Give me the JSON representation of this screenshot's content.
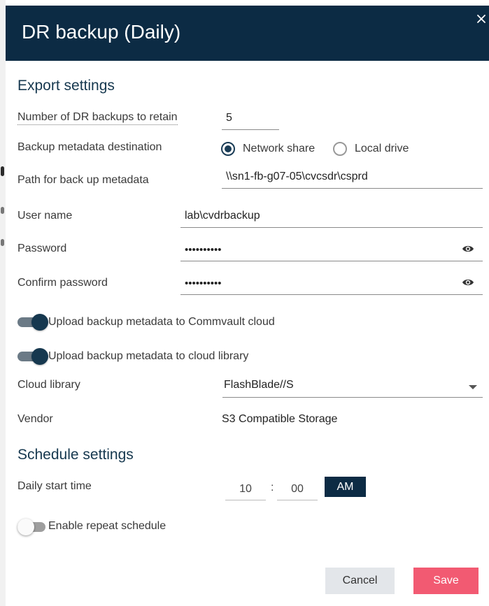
{
  "dialog": {
    "title": "DR backup (Daily)",
    "close_icon": "close-icon",
    "colors": {
      "header": "#0c2b44",
      "accent": "#16384f",
      "save": "#f25a72"
    }
  },
  "export_settings": {
    "title": "Export settings",
    "retain_label": "Number of DR backups to retain",
    "retain_value": "5",
    "destination_label": "Backup metadata destination",
    "destination_options": [
      {
        "label": "Network share",
        "selected": true
      },
      {
        "label": "Local drive",
        "selected": false
      }
    ],
    "path_label": "Path for back up metadata",
    "path_value": "\\\\sn1-fb-g07-05\\cvcsdr\\csprd",
    "username_label": "User name",
    "username_value": "lab\\cvdrbackup",
    "password_label": "Password",
    "password_value": "••••••••••",
    "confirm_password_label": "Confirm password",
    "confirm_password_value": "••••••••••",
    "upload_commvault_label": "Upload backup metadata to Commvault cloud",
    "upload_commvault_enabled": true,
    "upload_library_label": "Upload backup metadata to cloud library",
    "upload_library_enabled": true,
    "cloud_library_label": "Cloud library",
    "cloud_library_value": "FlashBlade//S",
    "vendor_label": "Vendor",
    "vendor_value": "S3 Compatible Storage"
  },
  "schedule_settings": {
    "title": "Schedule settings",
    "start_time_label": "Daily start time",
    "hour": "10",
    "separator": ":",
    "minute": "00",
    "ampm": "AM",
    "repeat_label": "Enable repeat schedule",
    "repeat_enabled": false
  },
  "footer": {
    "cancel_label": "Cancel",
    "save_label": "Save"
  }
}
